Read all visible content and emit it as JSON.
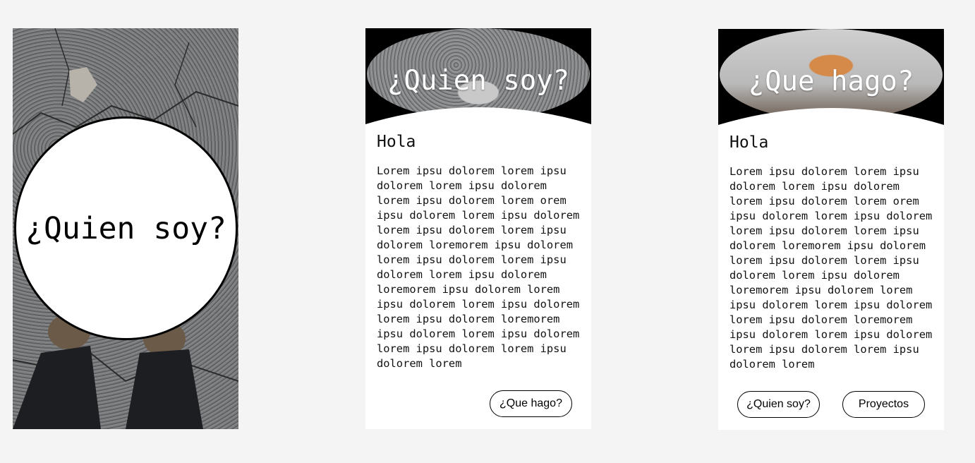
{
  "frame1": {
    "title": "¿Quien soy?"
  },
  "frame2": {
    "header_title": "¿Quien soy?",
    "heading": "Hola",
    "body": "Lorem ipsu dolorem lorem ipsu dolorem lorem ipsu dolorem lorem ipsu dolorem lorem orem ipsu dolorem lorem ipsu dolorem lorem ipsu dolorem lorem ipsu dolorem loremorem ipsu dolorem lorem ipsu dolorem lorem ipsu dolorem lorem ipsu dolorem loremorem ipsu dolorem lorem ipsu dolorem lorem ipsu dolorem lorem ipsu dolorem loremorem ipsu dolorem lorem ipsu dolorem lorem ipsu dolorem lorem ipsu dolorem lorem",
    "next_button": "¿Que hago?"
  },
  "frame3": {
    "header_title": "¿Que hago?",
    "heading": "Hola",
    "body": "Lorem ipsu dolorem lorem ipsu dolorem lorem ipsu dolorem lorem ipsu dolorem lorem orem ipsu dolorem lorem ipsu dolorem lorem ipsu dolorem lorem ipsu dolorem loremorem ipsu dolorem lorem ipsu dolorem lorem ipsu dolorem lorem ipsu dolorem loremorem ipsu dolorem lorem ipsu dolorem lorem ipsu dolorem lorem ipsu dolorem loremorem ipsu dolorem lorem ipsu dolorem lorem ipsu dolorem lorem ipsu dolorem lorem",
    "prev_button": "¿Quien soy?",
    "next_button": "Proyectos"
  },
  "colors": {
    "canvas": "#f4f4f4",
    "card": "#ffffff",
    "header": "#000000",
    "text": "#111111"
  }
}
